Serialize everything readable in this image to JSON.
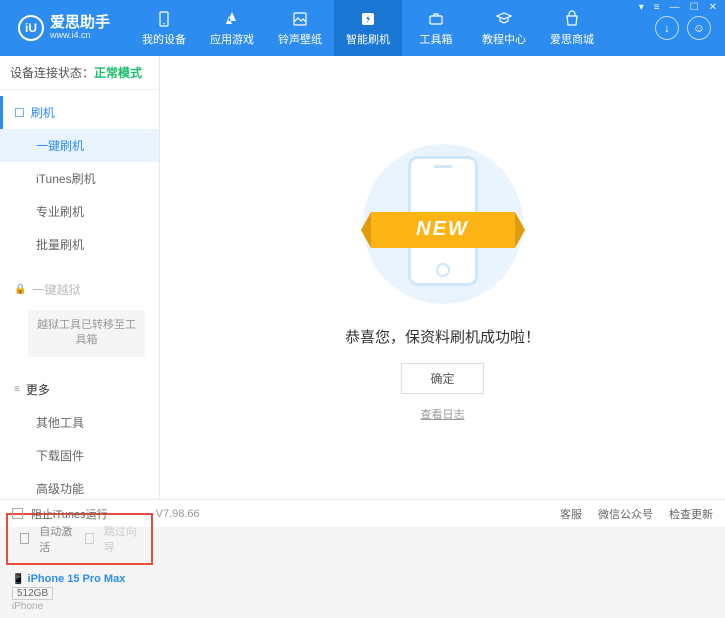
{
  "header": {
    "logo_char": "iU",
    "title": "爱思助手",
    "subtitle": "www.i4.cn",
    "nav": [
      {
        "label": "我的设备"
      },
      {
        "label": "应用游戏"
      },
      {
        "label": "铃声壁纸"
      },
      {
        "label": "智能刷机"
      },
      {
        "label": "工具箱"
      },
      {
        "label": "教程中心"
      },
      {
        "label": "爱思商城"
      }
    ]
  },
  "sidebar": {
    "status_label": "设备连接状态：",
    "status_value": "正常模式",
    "flash_head": "刷机",
    "flash_items": [
      "一键刷机",
      "iTunes刷机",
      "专业刷机",
      "批量刷机"
    ],
    "jailbreak_head": "一键越狱",
    "jailbreak_note": "越狱工具已转移至工具箱",
    "more_head": "更多",
    "more_items": [
      "其他工具",
      "下载固件",
      "高级功能"
    ],
    "auto_activate": "自动激活",
    "skip_guide": "跳过向导",
    "device": {
      "name": "iPhone 15 Pro Max",
      "storage": "512GB",
      "type": "iPhone"
    }
  },
  "main": {
    "ribbon": "NEW",
    "success": "恭喜您，保资料刷机成功啦！",
    "ok": "确定",
    "log": "查看日志"
  },
  "footer": {
    "block_itunes": "阻止iTunes运行",
    "version": "V7.98.66",
    "links": [
      "客服",
      "微信公众号",
      "检查更新"
    ]
  }
}
